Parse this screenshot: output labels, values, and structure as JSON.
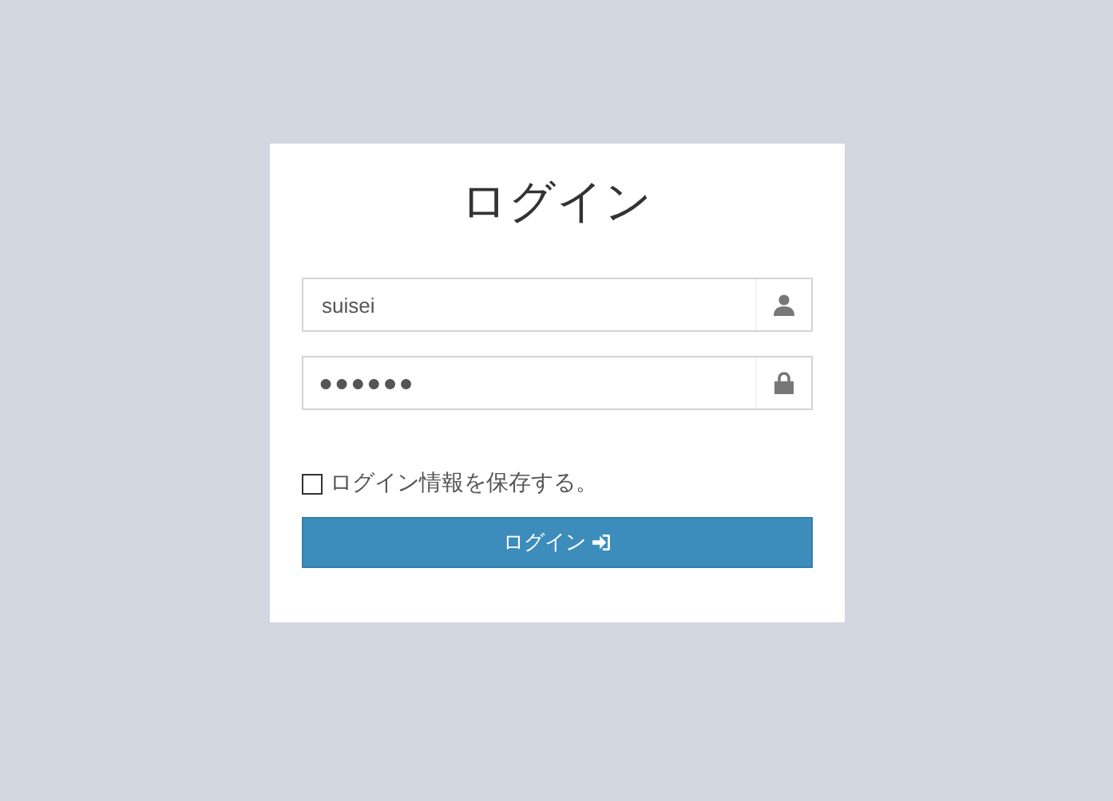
{
  "title": "ログイン",
  "fields": [
    {
      "kind": "user",
      "value": "suisei"
    },
    {
      "kind": "password",
      "value": "●●●●●●"
    }
  ],
  "remember": {
    "label": "ログイン情報を保存する。",
    "checked": false
  },
  "submit": {
    "label": "ログイン"
  }
}
